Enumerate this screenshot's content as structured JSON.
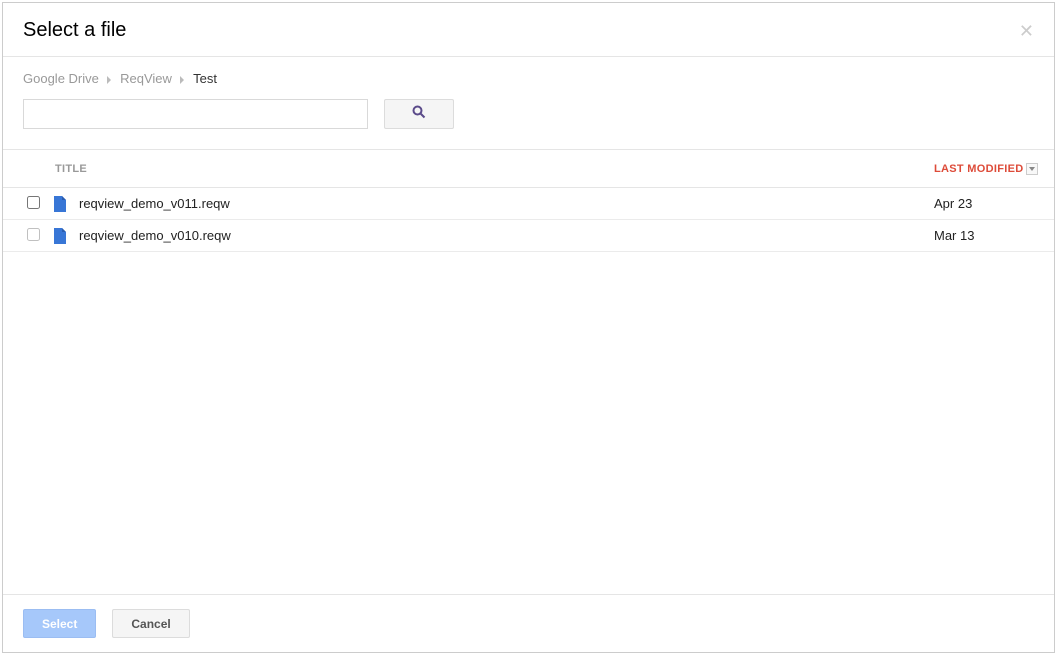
{
  "dialog": {
    "title": "Select a file"
  },
  "breadcrumb": {
    "items": [
      "Google Drive",
      "ReqView",
      "Test"
    ]
  },
  "search": {
    "value": "",
    "placeholder": ""
  },
  "table": {
    "headers": {
      "title": "TITLE",
      "modified": "LAST MODIFIED"
    },
    "rows": [
      {
        "title": "reqview_demo_v011.reqw",
        "modified": "Apr 23",
        "checked": false
      },
      {
        "title": "reqview_demo_v010.reqw",
        "modified": "Mar 13",
        "checked": false
      }
    ]
  },
  "footer": {
    "select_label": "Select",
    "cancel_label": "Cancel"
  },
  "colors": {
    "accent_blue": "#1a73e8",
    "file_icon_blue": "#3876d6",
    "header_sort_active": "#dd4b39",
    "select_btn_bg": "#a6c8fa"
  }
}
